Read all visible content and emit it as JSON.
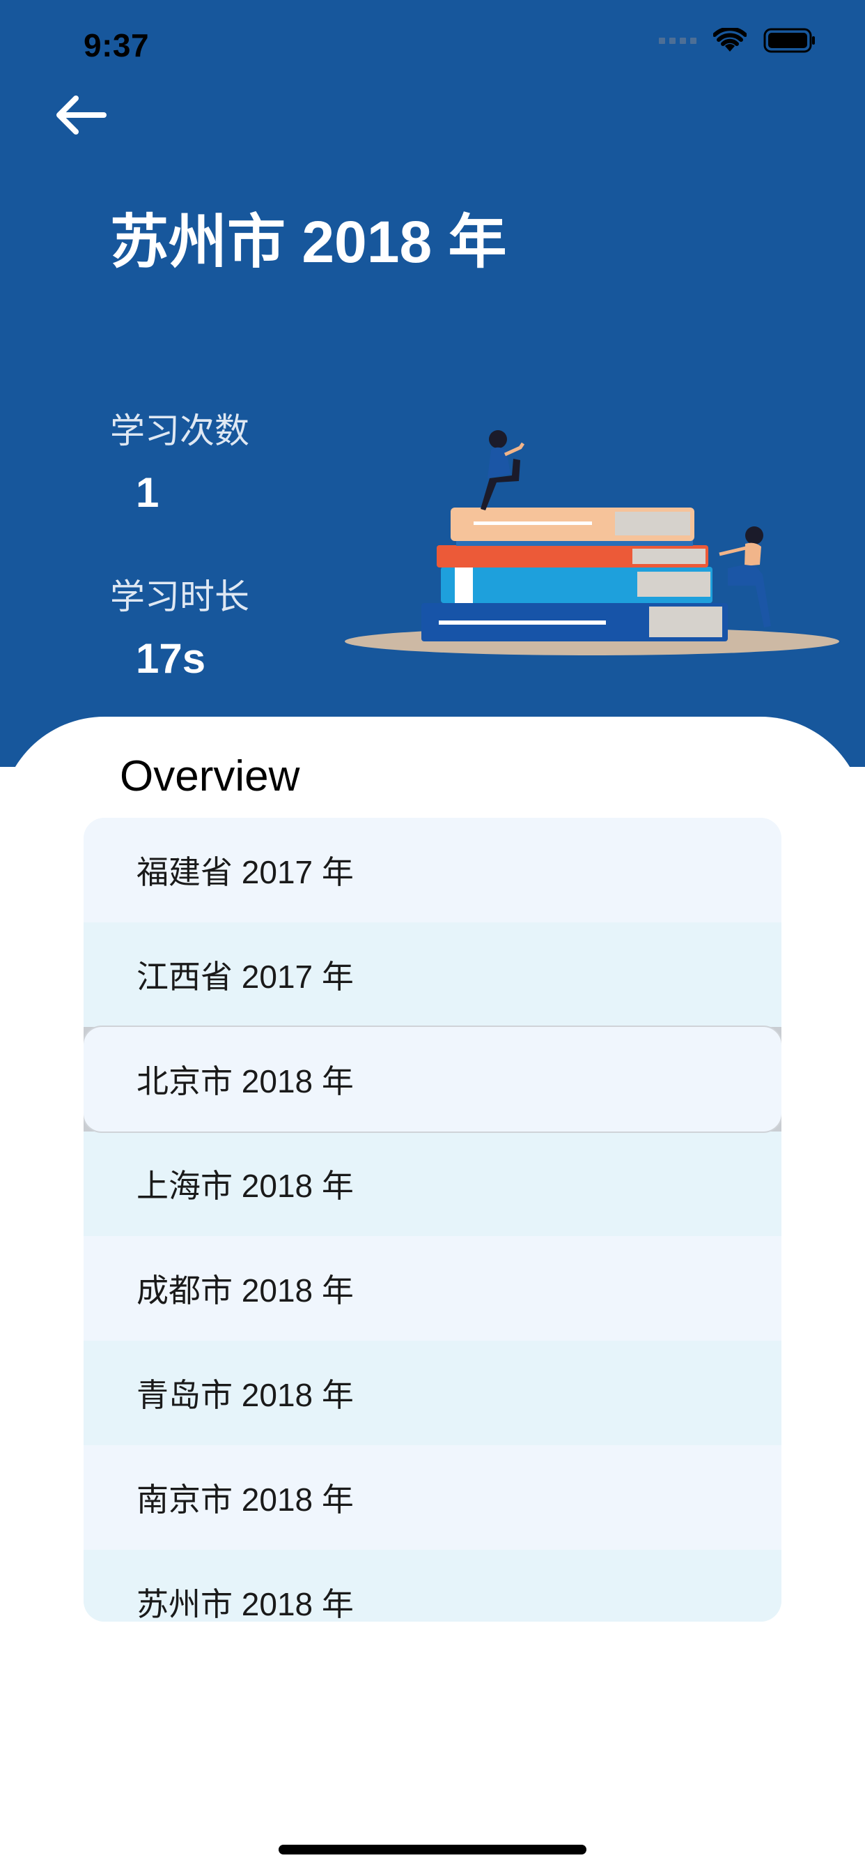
{
  "status_bar": {
    "time": "9:37"
  },
  "header": {
    "title": "苏州市 2018 年",
    "stats": [
      {
        "label": "学习次数",
        "value": "1"
      },
      {
        "label": "学习时长",
        "value": "17s"
      }
    ]
  },
  "overview": {
    "title": "Overview",
    "items": [
      {
        "label": "福建省 2017 年"
      },
      {
        "label": "江西省 2017 年"
      },
      {
        "label": "北京市 2018 年"
      },
      {
        "label": "上海市 2018 年"
      },
      {
        "label": "成都市 2018 年"
      },
      {
        "label": "青岛市 2018 年"
      },
      {
        "label": "南京市 2018 年"
      },
      {
        "label": "苏州市 2018 年"
      }
    ],
    "selected_index": 2
  },
  "colors": {
    "header_bg": "#17579c",
    "row_odd": "#f0f6fd",
    "row_even": "#e6f4fa"
  },
  "icons": {
    "back": "arrow-left-icon",
    "wifi": "wifi-icon",
    "battery": "battery-icon"
  }
}
